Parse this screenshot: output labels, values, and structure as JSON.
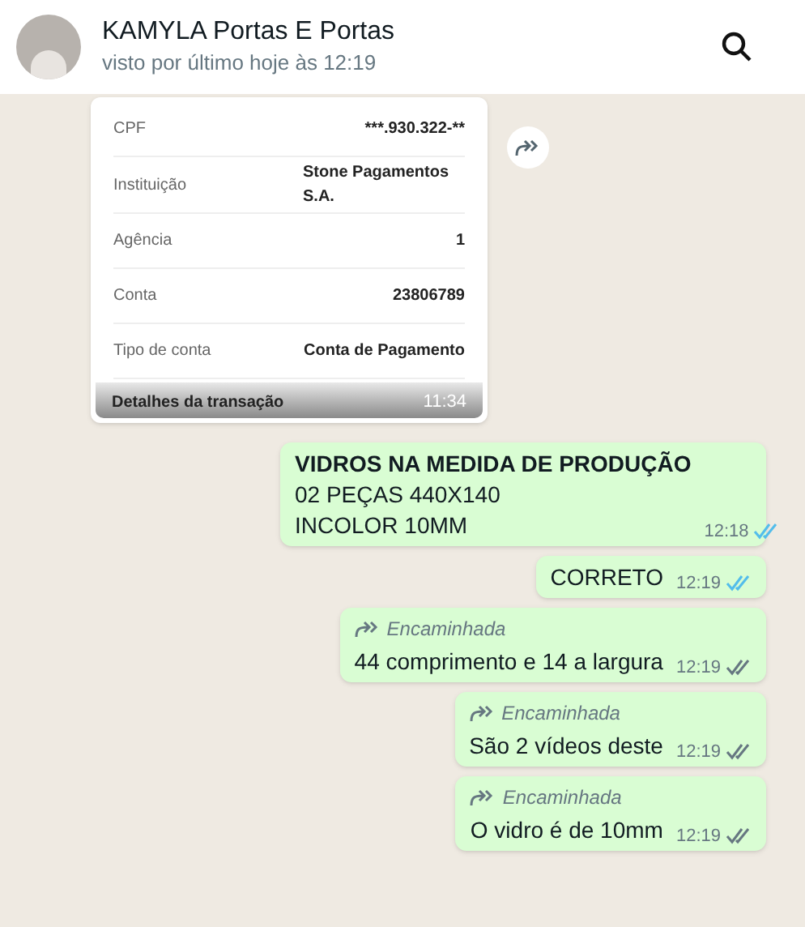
{
  "header": {
    "name": "KAMYLA Portas E Portas",
    "status": "visto por último hoje às 12:19"
  },
  "image_message": {
    "rows": [
      {
        "label": "CPF",
        "value": "***.930.322-**"
      },
      {
        "label": "Instituição",
        "value": "Stone Pagamentos S.A."
      },
      {
        "label": "Agência",
        "value": "1"
      },
      {
        "label": "Conta",
        "value": "23806789"
      },
      {
        "label": "Tipo de conta",
        "value": "Conta de Pagamento"
      }
    ],
    "footer_heading": "Detalhes da transação",
    "time": "11:34"
  },
  "messages": [
    {
      "forwarded": false,
      "text": "**VIDROS NA MEDIDA DE PRODUÇÃO**\n02 PEÇAS 440X140\nINCOLOR 10MM",
      "time": "12:18",
      "read": true
    },
    {
      "forwarded": false,
      "text": "CORRETO",
      "time": "12:19",
      "read": true
    },
    {
      "forwarded": true,
      "forward_label": "Encaminhada",
      "text": "44 comprimento e 14 a largura",
      "time": "12:19",
      "read": false
    },
    {
      "forwarded": true,
      "forward_label": "Encaminhada",
      "text": "São 2 vídeos deste",
      "time": "12:19",
      "read": false
    },
    {
      "forwarded": true,
      "forward_label": "Encaminhada",
      "text": "O vidro é de 10mm",
      "time": "12:19",
      "read": false
    }
  ]
}
